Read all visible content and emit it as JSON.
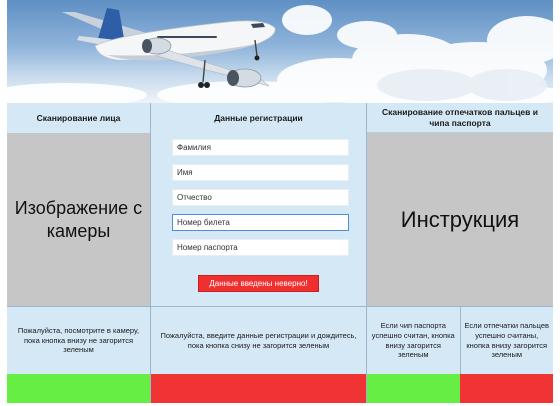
{
  "colors": {
    "panel_blue": "#d5e8f6",
    "camera_gray": "#c6c6c6",
    "status_green": "#66ee44",
    "status_red": "#f03434",
    "error_red": "#f02f2f"
  },
  "banner": {
    "icon": "airplane-icon"
  },
  "face_scan": {
    "header": "Сканирование лица",
    "camera_placeholder": "Изображение с камеры",
    "note": "Пожалуйста, посмотрите в камеру, пока кнопка внизу не загорится зеленым",
    "status": "green"
  },
  "registration": {
    "header": "Данные регистрации",
    "fields": [
      {
        "placeholder": "Фамилия"
      },
      {
        "placeholder": "Имя"
      },
      {
        "placeholder": "Отчество"
      },
      {
        "placeholder": "Номер билета"
      },
      {
        "placeholder": "Номер паспорта"
      }
    ],
    "error": "Данные введены неверно!",
    "note": "Пожалуйста, введите данные регистрации и дождитесь, пока кнопка снизу не загорится зеленым",
    "status": "red"
  },
  "scan_right": {
    "header": "Сканирование отпечатков пальцев и чипа паспорта",
    "instruction": "Инструкция",
    "note_chip": "Если чип паспорта успешно считан, кнопка внизу загорится зеленым",
    "note_fingerprints": "Если отпечатки пальцев успешно считаны, кнопка внизу загорится зеленым",
    "status_chip": "green",
    "status_fingerprints": "red"
  }
}
